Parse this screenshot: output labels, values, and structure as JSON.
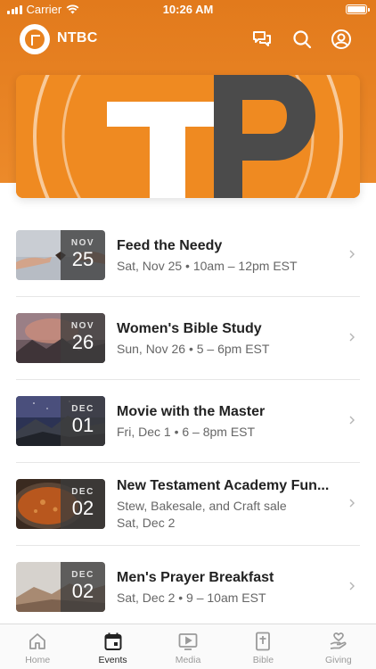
{
  "status_bar": {
    "carrier": "Carrier",
    "time": "10:26 AM"
  },
  "header": {
    "brand": "NTBC"
  },
  "events": [
    {
      "month": "NOV",
      "day": "25",
      "title": "Feed the Needy",
      "line1": "Sat, Nov 25 • 10am – 12pm EST",
      "line2": ""
    },
    {
      "month": "NOV",
      "day": "26",
      "title": "Women's Bible Study",
      "line1": "Sun, Nov 26 • 5 – 6pm EST",
      "line2": ""
    },
    {
      "month": "DEC",
      "day": "01",
      "title": "Movie with the Master",
      "line1": "Fri, Dec 1 • 6 – 8pm EST",
      "line2": ""
    },
    {
      "month": "DEC",
      "day": "02",
      "title": "New Testament Academy Fun...",
      "line1": "Stew, Bakesale, and Craft sale",
      "line2": "Sat, Dec 2"
    },
    {
      "month": "DEC",
      "day": "02",
      "title": "Men's Prayer Breakfast",
      "line1": "Sat, Dec 2 • 9 – 10am EST",
      "line2": ""
    }
  ],
  "tabs": [
    {
      "label": "Home",
      "icon": "home-icon",
      "active": false
    },
    {
      "label": "Events",
      "icon": "calendar-icon",
      "active": true
    },
    {
      "label": "Media",
      "icon": "play-screen-icon",
      "active": false
    },
    {
      "label": "Bible",
      "icon": "bible-icon",
      "active": false
    },
    {
      "label": "Giving",
      "icon": "giving-hand-icon",
      "active": false
    }
  ],
  "colors": {
    "brand_orange": "#ec8a2a",
    "active_tab": "#222222",
    "inactive_tab": "#9a9a9a"
  }
}
